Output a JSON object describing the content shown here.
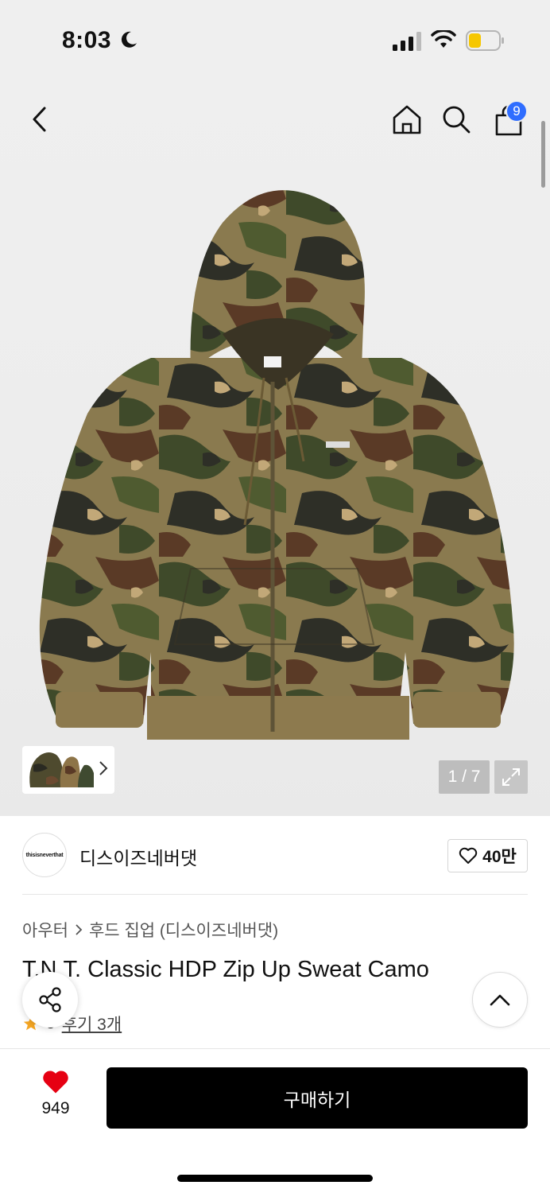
{
  "status_bar": {
    "time": "8:03"
  },
  "header": {
    "cart_count": "9"
  },
  "gallery": {
    "counter": "1 / 7"
  },
  "brand": {
    "logo_text": "thisisneverthat",
    "name": "디스이즈네버댓",
    "likes": "40만"
  },
  "product": {
    "breadcrumb": [
      "아우터",
      "후드 집업 (디스이즈네버댓)"
    ],
    "title": "T.N.T. Classic HDP Zip Up Sweat Camo",
    "rating": "5",
    "review_label": "후기 3개"
  },
  "bottom_bar": {
    "wish_count": "949",
    "buy_label": "구매하기"
  },
  "colors": {
    "accent_blue": "#2f6dff",
    "heart_red": "#e60012",
    "star_orange": "#f5a623",
    "buy_bg": "#000000"
  },
  "icons": [
    "moon-icon",
    "signal-icon",
    "wifi-icon",
    "battery-icon",
    "back-arrow-icon",
    "home-icon",
    "search-icon",
    "shopping-bag-icon",
    "chevron-right-icon",
    "expand-icon",
    "heart-outline-icon",
    "share-icon",
    "chevron-up-icon",
    "star-icon",
    "heart-filled-icon"
  ]
}
